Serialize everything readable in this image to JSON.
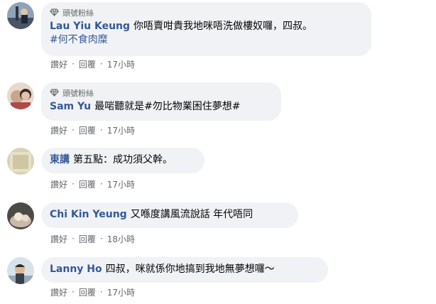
{
  "badge_label": "頭號粉絲",
  "actions": {
    "like": "讚好",
    "reply": "回覆",
    "separator": "·"
  },
  "comments": [
    {
      "author": "Lau Yiu Keung",
      "text": "你唔賣咁貴我地咪唔洗做樓奴囉，四叔。",
      "hashtag": "#何不食肉糜",
      "has_badge": true,
      "time": "17小時"
    },
    {
      "author": "Sam Yu",
      "text": "最啱聽就是#勿比物業困住夢想#",
      "has_badge": true,
      "time": "17小時"
    },
    {
      "author": "東講",
      "text": "第五點：成功須父幹。",
      "has_badge": false,
      "time": "17小時"
    },
    {
      "author": "Chi Kin Yeung",
      "text": "又喺度講風流說話 年代唔同",
      "has_badge": false,
      "time": "18小時"
    },
    {
      "author": "Lanny Ho",
      "text": "四叔，咪就係你地搞到我地無夢想囉～",
      "has_badge": false,
      "time": "17小時"
    }
  ],
  "colors": {
    "bubble_bg": "#f0f2f5",
    "author": "#365899",
    "meta": "#65676b",
    "text": "#050505"
  }
}
